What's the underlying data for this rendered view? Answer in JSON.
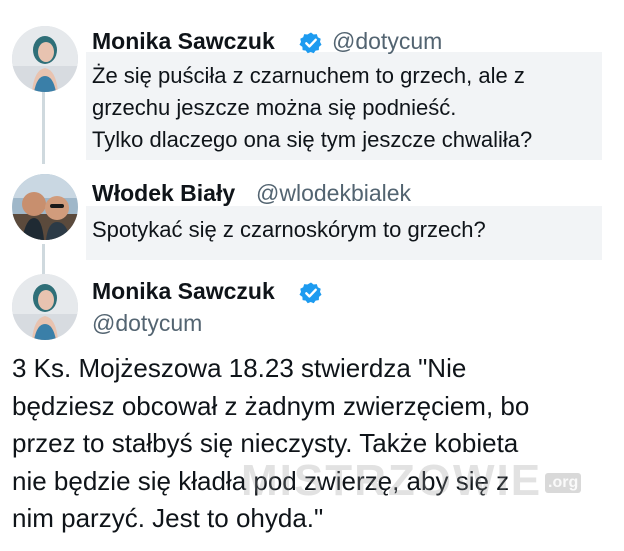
{
  "top": {
    "text": ""
  },
  "tweets": [
    {
      "name": "Monika Sawczuk",
      "handle": "@dotycum",
      "verified": true,
      "lines": [
        "Że się puściła z czarnuchem to grzech, ale z",
        "grzechu jeszcze można się podnieść.",
        "Tylko dlaczego ona się tym jeszcze chwaliła?"
      ]
    },
    {
      "name": "Włodek Biały",
      "handle": "@wlodekbialek",
      "verified": false,
      "lines": [
        "Spotykać się z czarnoskórym to grzech?"
      ]
    },
    {
      "name": "Monika Sawczuk",
      "handle": "@dotycum",
      "verified": true,
      "lines": [
        "3 Ks. Mojżeszowa 18.23 stwierdza \"Nie",
        "będziesz obcował z żadnym zwierzęciem, bo",
        "przez to stałbyś się  nieczysty. Także kobieta",
        "nie będzie się kładła pod zwierzę, aby się z",
        "nim parzyć. Jest to ohyda.\""
      ]
    }
  ],
  "watermark": {
    "text": "MISTRZOWIE",
    "suffix": ".org"
  },
  "colors": {
    "verified": "#1d9bf0",
    "handle": "#536471",
    "text": "#0f1419",
    "highlight": "#f2f4f6"
  }
}
